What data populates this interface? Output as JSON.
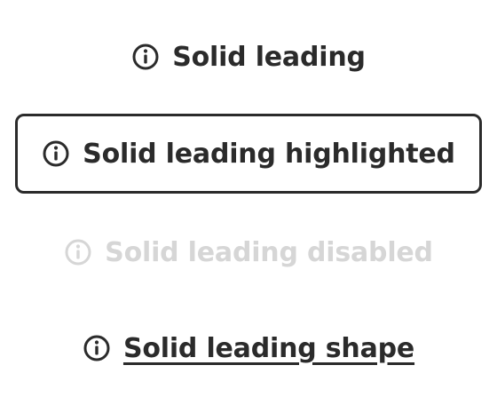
{
  "buttons": {
    "solid_leading": {
      "label": "Solid leading",
      "icon": "info-circle-icon"
    },
    "solid_leading_highlighted": {
      "label": "Solid leading highlighted",
      "icon": "info-circle-icon"
    },
    "solid_leading_disabled": {
      "label": "Solid leading disabled",
      "icon": "info-circle-icon",
      "disabled": true
    },
    "solid_leading_shape": {
      "label": "Solid leading shape",
      "icon": "info-circle-icon"
    }
  },
  "colors": {
    "text": "#2b2b2b",
    "disabled": "#d6d6d6",
    "background": "#ffffff"
  }
}
